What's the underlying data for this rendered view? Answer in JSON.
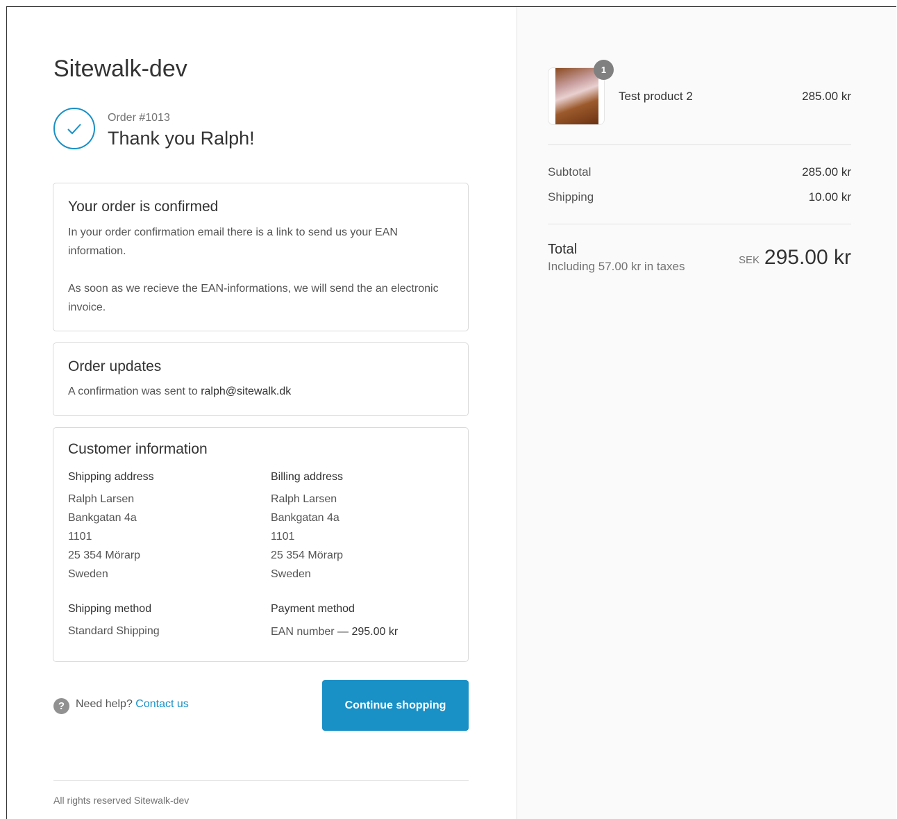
{
  "store": {
    "name": "Sitewalk-dev"
  },
  "header": {
    "order_number": "Order #1013",
    "thank_you": "Thank you Ralph!"
  },
  "confirmed": {
    "title": "Your order is confirmed",
    "para1": "In your order confirmation email there is a link to send us your EAN information.",
    "para2": "As soon as we recieve the EAN-informations, we will send the an electronic invoice."
  },
  "updates": {
    "title": "Order updates",
    "text_prefix": "A confirmation was sent to ",
    "email": "ralph@sitewalk.dk"
  },
  "customer": {
    "title": "Customer information",
    "shipping_address": {
      "label": "Shipping address",
      "lines": [
        "Ralph Larsen",
        "Bankgatan 4a",
        "1101",
        "25 354 Mörarp",
        "Sweden"
      ]
    },
    "billing_address": {
      "label": "Billing address",
      "lines": [
        "Ralph Larsen",
        "Bankgatan 4a",
        "1101",
        "25 354 Mörarp",
        "Sweden"
      ]
    },
    "shipping_method": {
      "label": "Shipping method",
      "value": "Standard Shipping"
    },
    "payment_method": {
      "label": "Payment method",
      "value_prefix": "EAN number — ",
      "amount": "295.00 kr"
    }
  },
  "help": {
    "icon": "?",
    "text": "Need help?",
    "link": "Contact us"
  },
  "actions": {
    "continue_label": "Continue shopping"
  },
  "footer": {
    "text": "All rights reserved Sitewalk-dev"
  },
  "summary": {
    "product": {
      "name": "Test product 2",
      "price": "285.00 kr",
      "quantity": "1"
    },
    "subtotal": {
      "label": "Subtotal",
      "value": "285.00 kr"
    },
    "shipping": {
      "label": "Shipping",
      "value": "10.00 kr"
    },
    "total": {
      "label": "Total",
      "tax_note": "Including 57.00 kr in taxes",
      "currency": "SEK",
      "amount": "295.00 kr"
    }
  },
  "colors": {
    "accent": "#1990c6",
    "sidebar_bg": "#fafafa",
    "border": "#d9d9d9"
  }
}
